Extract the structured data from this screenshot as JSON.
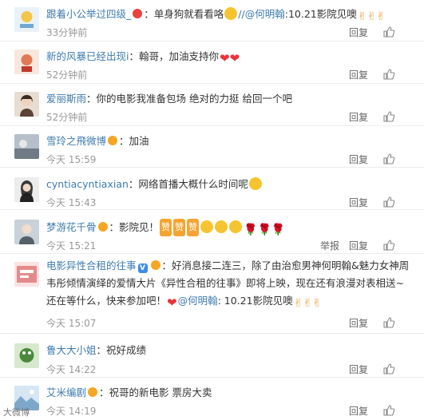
{
  "comments": [
    {
      "user": "跟着小公举过四级_",
      "sep": "：",
      "text": "单身狗就看看咯",
      "mention": "//@何明翰",
      "tail": ":10.21影院见噢",
      "time": "33分钟前",
      "reply": "回复",
      "avatar_color": "#cfe3f2"
    },
    {
      "user": "新的风暴已经出现i",
      "sep": "：",
      "text": "翰哥，加油支持你",
      "time": "52分钟前",
      "reply": "回复",
      "avatar_color": "#f2d6c9"
    },
    {
      "user": "爱丽斯雨",
      "sep": "：",
      "text": "你的电影我准备包场 绝对的力挺 给回一个吧",
      "time": "52分钟前",
      "reply": "回复",
      "avatar_color": "#c8b8a8"
    },
    {
      "user": "雪玲之飛微博",
      "sep": "：",
      "text": "加油",
      "time": "今天 15:59",
      "reply": "回复",
      "avatar_color": "#9aa5b1"
    },
    {
      "user": "cyntiacyntiaxian",
      "sep": "：",
      "text": "网络首播大概什么时间呢",
      "time": "今天 15:43",
      "reply": "回复",
      "avatar_color": "#3a3a3a"
    },
    {
      "user": "梦游花千骨",
      "sep": "：",
      "text": "影院见！",
      "zan": "赞",
      "time": "今天 15:21",
      "report": "举报",
      "reply": "回复",
      "avatar_color": "#7f8fa0"
    },
    {
      "user": "电影异性合租的往事",
      "sep": "：",
      "text": "好消息接二连三，除了由治愈男神何明翰&魅力女神周韦彤倾情演绎的爱情大片《异性合租的往事》即将上映，现在还有浪漫对表相送~还在等什么，快来参加吧！",
      "mention": "@何明翰",
      "tail": ": 10.21影院见噢",
      "time": "今天 15:07",
      "reply": "回复",
      "avatar_color": "#e9a3a3"
    },
    {
      "user": "鲁大大小姐",
      "sep": "：",
      "text": "祝好成绩",
      "time": "今天 14:22",
      "reply": "回复",
      "avatar_color": "#4b8a3c"
    },
    {
      "user": "艾米编剧",
      "sep": "：",
      "text": "祝哥的新电影 票房大卖",
      "time": "今天 14:19",
      "reply": "回复",
      "avatar_color": "#a8c6e0"
    }
  ],
  "watermark": "大微博",
  "icons": {
    "like": "thumbs-up-icon",
    "vip": "vip-badge-icon",
    "verified": "verified-v-icon"
  },
  "colors": {
    "username": "#3d7bb0",
    "time": "#999999",
    "heart": "#e8333b"
  }
}
